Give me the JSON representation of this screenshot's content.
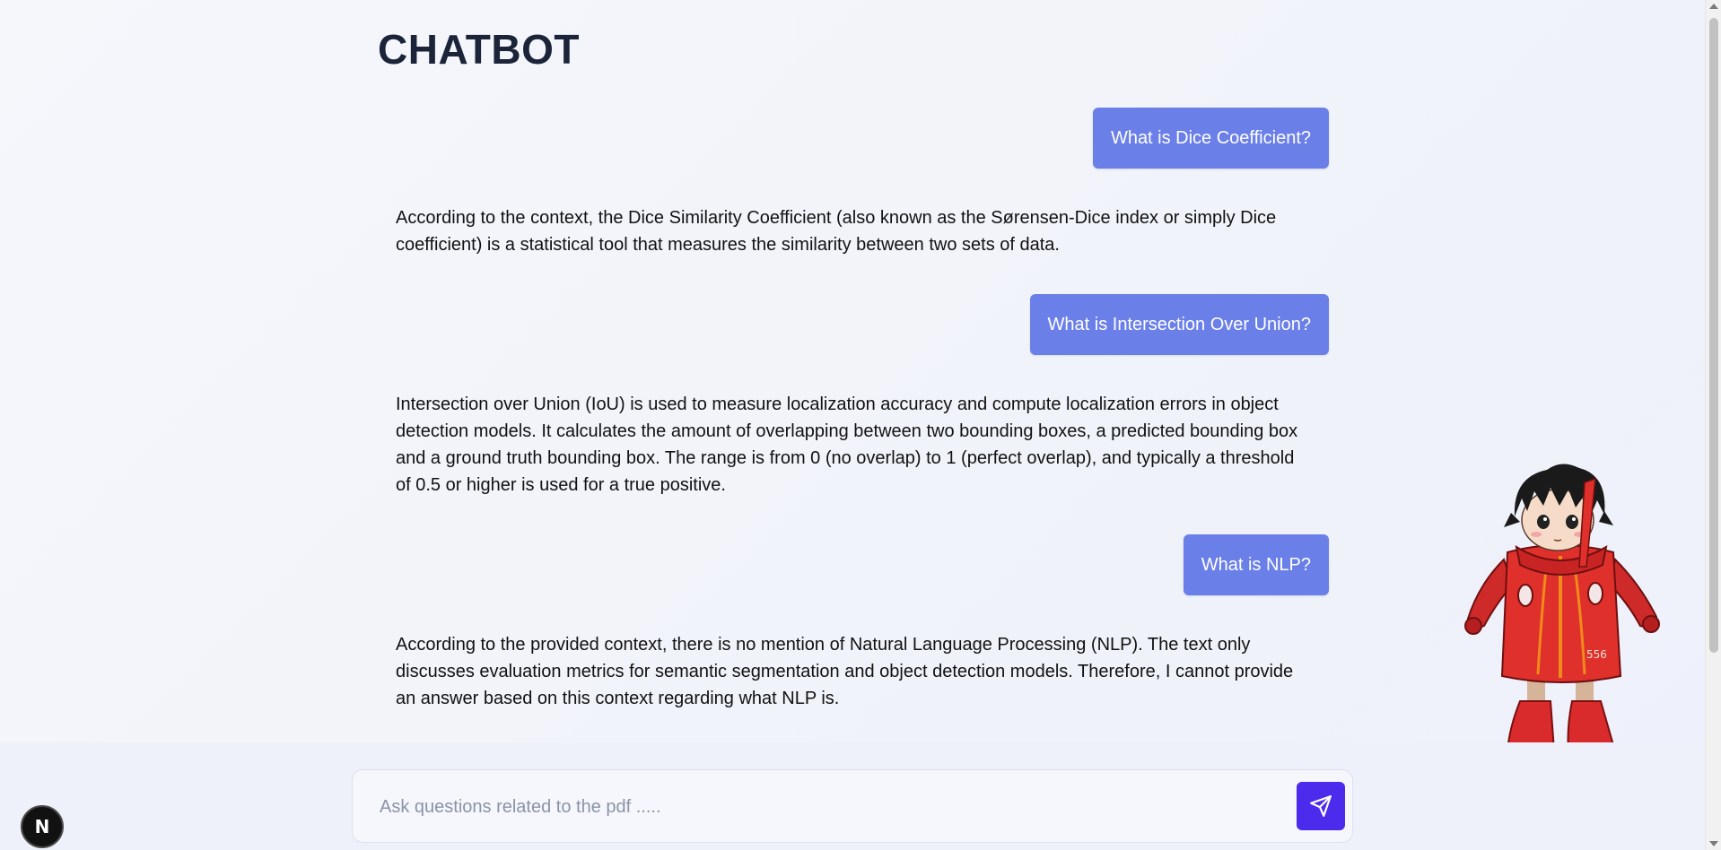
{
  "header": {
    "title": "CHATBOT"
  },
  "messages": [
    {
      "role": "user",
      "text": "What is Dice Coefficient?"
    },
    {
      "role": "bot",
      "text": "According to the context, the Dice Similarity Coefficient (also known as the Sørensen-Dice index or simply Dice coefficient) is a statistical tool that measures the similarity between two sets of data."
    },
    {
      "role": "user",
      "text": "What is Intersection Over Union?"
    },
    {
      "role": "bot",
      "text": "Intersection over Union (IoU) is used to measure localization accuracy and compute localization errors in object detection models. It calculates the amount of overlapping between two bounding boxes, a predicted bounding box and a ground truth bounding box. The range is from 0 (no overlap) to 1 (perfect overlap), and typically a threshold of 0.5 or higher is used for a true positive."
    },
    {
      "role": "user",
      "text": "What is NLP?"
    },
    {
      "role": "bot",
      "text": "According to the provided context, there is no mention of Natural Language Processing (NLP). The text only discusses evaluation metrics for semantic segmentation and object detection models. Therefore, I cannot provide an answer based on this context regarding what NLP is."
    }
  ],
  "composer": {
    "placeholder": "Ask questions related to the pdf .....",
    "value": "",
    "send_icon": "send-icon"
  },
  "dev_badge": {
    "label": "N"
  },
  "mascot": {
    "icon": "mascot-illustration"
  },
  "colors": {
    "user_bubble": "#6b7fe8",
    "send_button": "#4d2bec",
    "title": "#1b2438"
  }
}
